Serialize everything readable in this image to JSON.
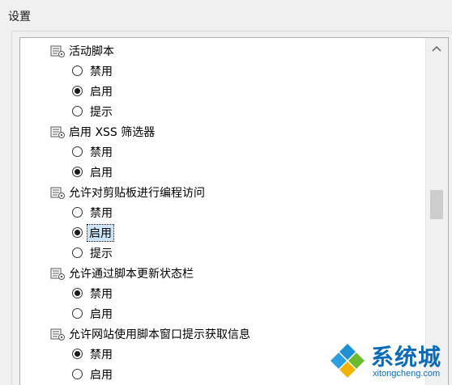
{
  "group_title": "设置",
  "settings": [
    {
      "label": "活动脚本",
      "icon": "script-settings-icon",
      "options": [
        {
          "label": "禁用",
          "checked": false
        },
        {
          "label": "启用",
          "checked": true
        },
        {
          "label": "提示",
          "checked": false
        }
      ]
    },
    {
      "label": "启用 XSS 筛选器",
      "icon": "script-settings-icon",
      "options": [
        {
          "label": "禁用",
          "checked": false
        },
        {
          "label": "启用",
          "checked": true
        }
      ]
    },
    {
      "label": "允许对剪贴板进行编程访问",
      "icon": "script-settings-icon",
      "options": [
        {
          "label": "禁用",
          "checked": false
        },
        {
          "label": "启用",
          "checked": true,
          "focused": true
        },
        {
          "label": "提示",
          "checked": false
        }
      ]
    },
    {
      "label": "允许通过脚本更新状态栏",
      "icon": "script-settings-icon",
      "options": [
        {
          "label": "禁用",
          "checked": true
        },
        {
          "label": "启用",
          "checked": false
        }
      ]
    },
    {
      "label": "允许网站使用脚本窗口提示获取信息",
      "icon": "script-settings-icon",
      "options": [
        {
          "label": "禁用",
          "checked": true
        },
        {
          "label": "启用",
          "checked": false
        }
      ]
    }
  ],
  "watermark": {
    "name": "系统城",
    "url": "xitongcheng.com"
  }
}
